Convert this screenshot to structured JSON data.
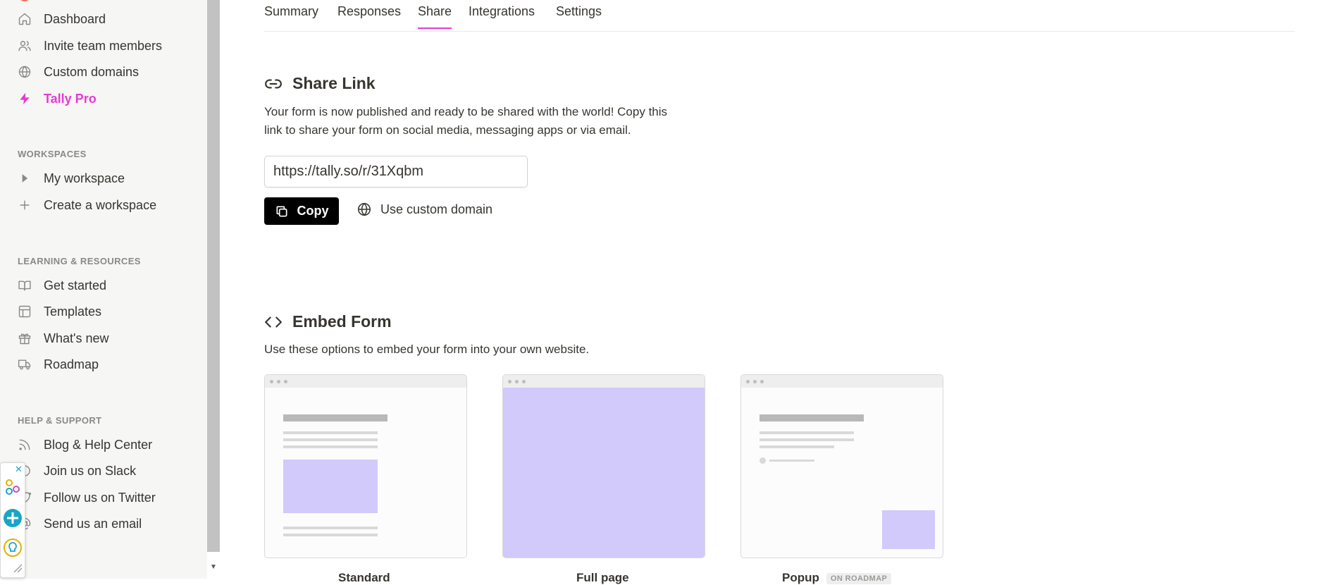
{
  "sidebar": {
    "main_items": [
      {
        "label": "Dashboard",
        "icon": "home-icon"
      },
      {
        "label": "Invite team members",
        "icon": "users-icon"
      },
      {
        "label": "Custom domains",
        "icon": "globe-icon"
      },
      {
        "label": "Tally Pro",
        "icon": "lightning-icon"
      }
    ],
    "workspaces": {
      "title": "WORKSPACES",
      "items": [
        {
          "label": "My workspace",
          "icon": "caret-right-icon"
        },
        {
          "label": "Create a workspace",
          "icon": "plus-icon"
        }
      ]
    },
    "learning": {
      "title": "LEARNING & RESOURCES",
      "items": [
        {
          "label": "Get started",
          "icon": "book-icon"
        },
        {
          "label": "Templates",
          "icon": "layout-icon"
        },
        {
          "label": "What's new",
          "icon": "gift-icon"
        },
        {
          "label": "Roadmap",
          "icon": "truck-icon"
        }
      ]
    },
    "help": {
      "title": "HELP & SUPPORT",
      "items": [
        {
          "label": "Blog & Help Center",
          "icon": "rss-icon"
        },
        {
          "label": "Join us on Slack",
          "icon": "chat-icon"
        },
        {
          "label": "Follow us on Twitter",
          "icon": "twitter-icon"
        },
        {
          "label": "Send us an email",
          "icon": "at-icon"
        }
      ]
    }
  },
  "tabs": [
    {
      "label": "Summary",
      "active": false
    },
    {
      "label": "Responses",
      "active": false
    },
    {
      "label": "Share",
      "active": true
    },
    {
      "label": "Integrations",
      "active": false
    },
    {
      "label": "Settings",
      "active": false
    }
  ],
  "share": {
    "title": "Share Link",
    "description_line1": "Your form is now published and ready to be shared with the world! Copy this",
    "description_line2": "link to share your form on social media, messaging apps or via email.",
    "link_value": "https://tally.so/r/31Xqbm",
    "copy_label": "Copy",
    "custom_domain_label": "Use custom domain"
  },
  "embed": {
    "title": "Embed Form",
    "description": "Use these options to embed your form into your own website.",
    "options": [
      {
        "label": "Standard",
        "badge": ""
      },
      {
        "label": "Full page",
        "badge": ""
      },
      {
        "label": "Popup",
        "badge": "ON ROADMAP"
      }
    ]
  },
  "colors": {
    "accent": "#e53bd2",
    "lavender": "#d1cafb",
    "button_bg": "#000000"
  }
}
